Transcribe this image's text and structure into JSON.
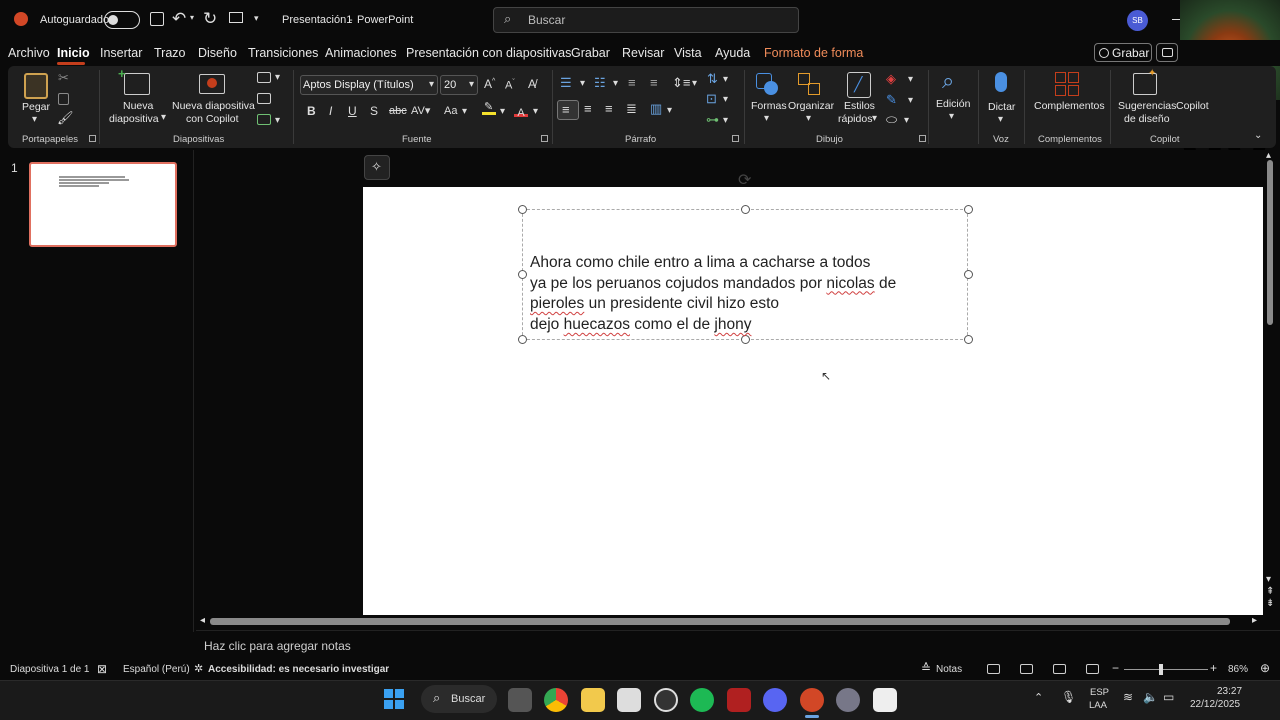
{
  "titlebar": {
    "autosave_label": "Autoguardado",
    "doc_title": "Presentación1",
    "separator": "-",
    "app_name": "PowerPoint",
    "search_placeholder": "Buscar",
    "user_initials": "SB"
  },
  "menu": {
    "items": [
      "Archivo",
      "Inicio",
      "Insertar",
      "Trazo",
      "Diseño",
      "Transiciones",
      "Animaciones",
      "Presentación con diapositivas",
      "Grabar",
      "Revisar",
      "Vista",
      "Ayuda",
      "Formato de forma"
    ],
    "record_button": "Grabar"
  },
  "ribbon": {
    "clipboard": {
      "paste": "Pegar",
      "group": "Portapapeles"
    },
    "slides": {
      "new_slide": "Nueva diapositiva",
      "new_slide_l1": "Nueva",
      "new_slide_l2": "diapositiva",
      "copilot_l1": "Nueva diapositiva",
      "copilot_l2": "con Copilot",
      "group": "Diapositivas"
    },
    "font": {
      "family": "Aptos Display (Títulos)",
      "size": "20",
      "bold": "B",
      "italic": "I",
      "underline": "U",
      "strike": "S",
      "case": "Aa",
      "group": "Fuente"
    },
    "paragraph": {
      "group": "Párrafo"
    },
    "drawing": {
      "shapes": "Formas",
      "arrange": "Organizar",
      "styles_l1": "Estilos",
      "styles_l2": "rápidos",
      "group": "Dibujo"
    },
    "editing": {
      "label": "Edición"
    },
    "voice": {
      "dictate": "Dictar",
      "group": "Voz"
    },
    "addins": {
      "label": "Complementos",
      "group": "Complementos"
    },
    "copilot": {
      "design_l1": "Sugerencias",
      "design_l2": "de diseño",
      "label": "Copilot",
      "group": "Copilot"
    }
  },
  "thumbnails": {
    "slide_number": "1"
  },
  "slide": {
    "lines": [
      "Ahora como chile entro a lima a cacharse a todos",
      "ya pe los peruanos cojudos mandados por ",
      "nicolas",
      " de",
      "pieroles",
      " un presidente civil hizo esto",
      "dejo ",
      "huecazos",
      " como el de ",
      "jhony"
    ]
  },
  "notes": {
    "placeholder": "Haz clic para agregar notas"
  },
  "status": {
    "slide_counter": "Diapositiva 1 de 1",
    "language": "Español (Perú)",
    "accessibility": "Accesibilidad: es necesario investigar",
    "notes": "Notas",
    "zoom": "86%"
  },
  "taskbar": {
    "search": "Buscar",
    "lang_l1": "ESP",
    "lang_l2": "LAA",
    "time": "23:27",
    "date": "22/12/2025"
  },
  "colors": {
    "accent": "#c43e1c",
    "shape_format_tab": "#f08c5a",
    "avatar": "#4a5bd4"
  }
}
